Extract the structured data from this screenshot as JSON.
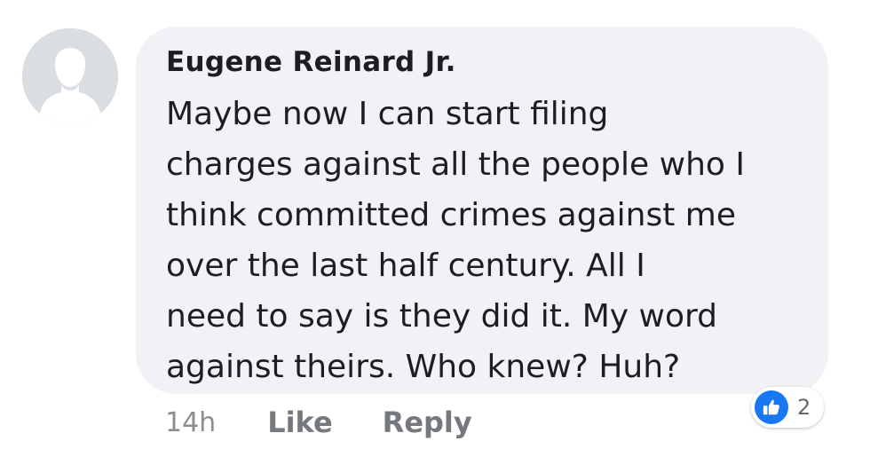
{
  "comment": {
    "author": "Eugene Reinard Jr.",
    "lines": [
      "Maybe now I can start filing",
      "charges against all the people who I",
      "think committed crimes against me",
      "over the last half century.  All I",
      "need to say is they did it. My word",
      "against theirs.  Who knew? Huh?"
    ],
    "avatar_icon": "default-profile-silhouette-icon"
  },
  "actions": {
    "time": "14h",
    "like_label": "Like",
    "reply_label": "Reply"
  },
  "reactions": {
    "icon": "thumbs-up-icon",
    "count": "2",
    "accent_color": "#1877f2"
  },
  "colors": {
    "bubble": "#f1f2f5",
    "text": "#1c1e21",
    "muted": "#8a8d91"
  }
}
